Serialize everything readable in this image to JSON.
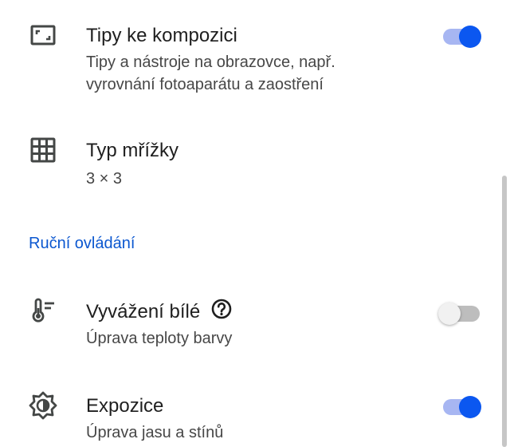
{
  "settings": {
    "composition": {
      "title": "Tipy ke kompozici",
      "subtitle_line1": "Tipy a nástroje na obrazovce, např.",
      "subtitle_line2": "vyrovnání fotoaparátu a zaostření",
      "icon": "composition-frame-icon",
      "enabled": true
    },
    "grid": {
      "title": "Typ mřížky",
      "subtitle": "3 × 3",
      "icon": "grid-icon"
    },
    "manual_section": {
      "header": "Ruční ovládání"
    },
    "white_balance": {
      "title": "Vyvážení bílé",
      "subtitle": "Úprava teploty barvy",
      "icon": "thermometer-icon",
      "help_icon": "help-circle-icon",
      "enabled": false
    },
    "exposure": {
      "title": "Expozice",
      "subtitle": "Úprava jasu a stínů",
      "icon": "exposure-icon",
      "enabled": true
    }
  },
  "colors": {
    "accent": "#0b57f0",
    "accent_track": "#a7b6f2",
    "section_header": "#0b57d0",
    "icon": "#444746",
    "title": "#1f1f1f",
    "subtitle": "#474747"
  }
}
